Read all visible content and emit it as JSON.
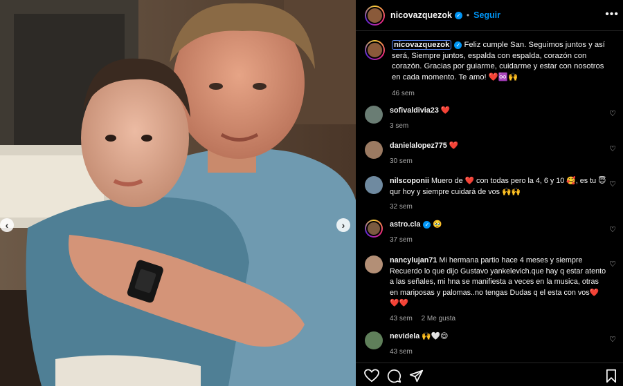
{
  "post": {
    "username": "nicovazquezok",
    "follow_label": "Seguir",
    "more_label": "•••",
    "separator": "•"
  },
  "caption": {
    "username": "nicovazquezok",
    "text": "Feliz cumple San. Seguimos juntos y así será, Siempre juntos, espalda con espalda, corazón con corazón. Gracias por guiarme, cuidarme y estar con nosotros en cada momento. Te amo! ❤️♾️🙌",
    "time": "46 sem"
  },
  "comments": [
    {
      "username": "sofivaldivia23",
      "verified": false,
      "text": "❤️",
      "time": "3 sem",
      "likes": ""
    },
    {
      "username": "danielalopez775",
      "verified": false,
      "text": "❤️",
      "time": "30 sem",
      "likes": ""
    },
    {
      "username": "nilscoponii",
      "verified": false,
      "text": "Muero de ❤️ con todas pero la 4, 6 y 10 🥰, es tu 😇 qur hoy y siempre cuidará de vos 🙌🙌",
      "time": "32 sem",
      "likes": ""
    },
    {
      "username": "astro.cla",
      "verified": true,
      "text": "🥹",
      "time": "37 sem",
      "likes": ""
    },
    {
      "username": "nancylujan71",
      "verified": false,
      "text": "Mi hermana partio hace 4 meses y siempre Recuerdo lo que dijo Gustavo yankelevich.que hay q estar atento a las señales, mi hna se manifiesta a veces en la musica, otras en mariposas y palomas..no tengas Dudas q el esta con vos❤️❤️❤️",
      "time": "43 sem",
      "likes": "2 Me gusta"
    },
    {
      "username": "nevidela",
      "verified": false,
      "text": "🙌🤍😌",
      "time": "43 sem",
      "likes": ""
    }
  ],
  "icons": {
    "prev": "chevron-left-icon",
    "next": "chevron-right-icon",
    "like": "heart-icon",
    "comment": "comment-icon",
    "share": "send-icon",
    "save": "bookmark-icon"
  },
  "colors": {
    "accent": "#0095f6",
    "background": "#000000",
    "secondary_text": "#a8a8a8"
  }
}
